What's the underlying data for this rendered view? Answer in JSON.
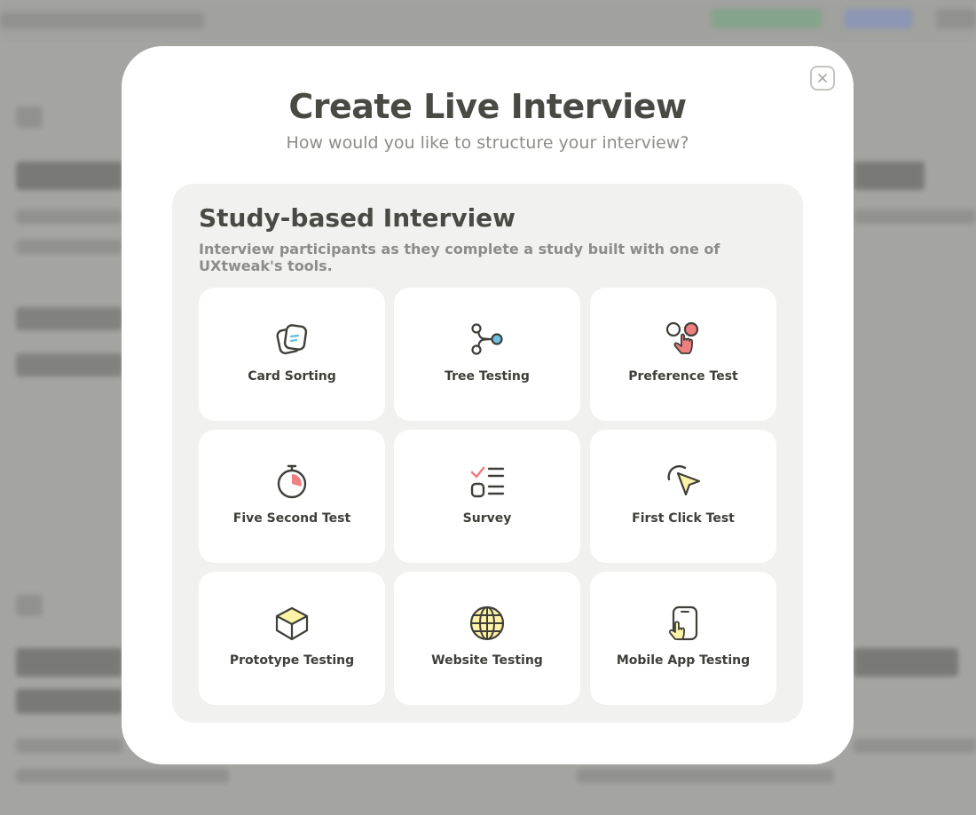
{
  "dialog": {
    "title": "Create Live Interview",
    "subtitle": "How would you like to structure your interview?",
    "close_label": "×"
  },
  "section": {
    "title": "Study-based Interview",
    "description": "Interview participants as they complete a study built with one of UXtweak's tools."
  },
  "tools": [
    {
      "label": "Card Sorting",
      "icon": "card-sorting-icon"
    },
    {
      "label": "Tree Testing",
      "icon": "tree-testing-icon"
    },
    {
      "label": "Preference Test",
      "icon": "preference-test-icon"
    },
    {
      "label": "Five Second Test",
      "icon": "stopwatch-icon"
    },
    {
      "label": "Survey",
      "icon": "survey-icon"
    },
    {
      "label": "First Click Test",
      "icon": "cursor-click-icon"
    },
    {
      "label": "Prototype Testing",
      "icon": "box-icon"
    },
    {
      "label": "Website Testing",
      "icon": "globe-icon"
    },
    {
      "label": "Mobile App Testing",
      "icon": "mobile-tap-icon"
    }
  ],
  "colors": {
    "accent_blue": "#6cc1e0",
    "accent_red": "#f08080",
    "accent_yellow": "#fdf3a7",
    "text_dark": "#3f3f3a"
  }
}
